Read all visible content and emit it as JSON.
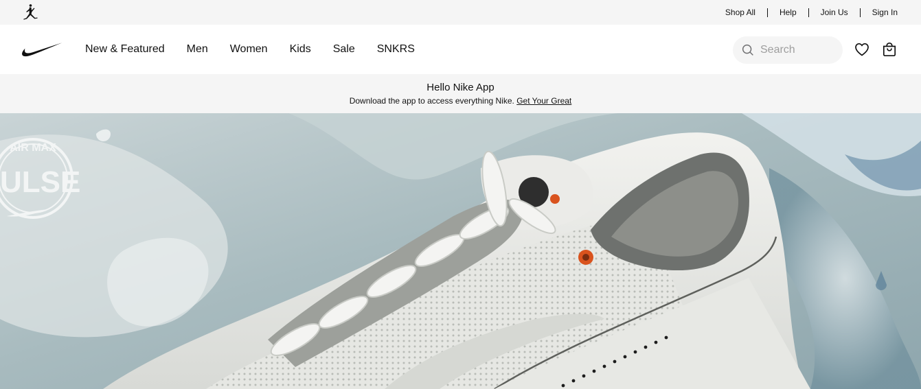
{
  "utility_bar": {
    "logo_icon": "jordan-jumpman-icon",
    "links": [
      "Shop All",
      "Help",
      "Join Us",
      "Sign In"
    ]
  },
  "main_nav": {
    "logo_icon": "nike-swoosh-icon",
    "items": [
      "New & Featured",
      "Men",
      "Women",
      "Kids",
      "Sale",
      "SNKRS"
    ],
    "search": {
      "placeholder": "Search",
      "icon": "search-icon"
    },
    "favorites_icon": "heart-icon",
    "bag_icon": "shopping-bag-icon"
  },
  "promo": {
    "title": "Hello Nike App",
    "text": "Download the app to access everything Nike.",
    "link": "Get Your Great"
  },
  "hero": {
    "emblem_text_top": "AIR MAX",
    "emblem_text_main": "PULSE"
  },
  "colors": {
    "utility_bg": "#f5f5f5",
    "text": "#111111",
    "placeholder": "#9e9e9e",
    "accent_orange": "#d9531e"
  }
}
